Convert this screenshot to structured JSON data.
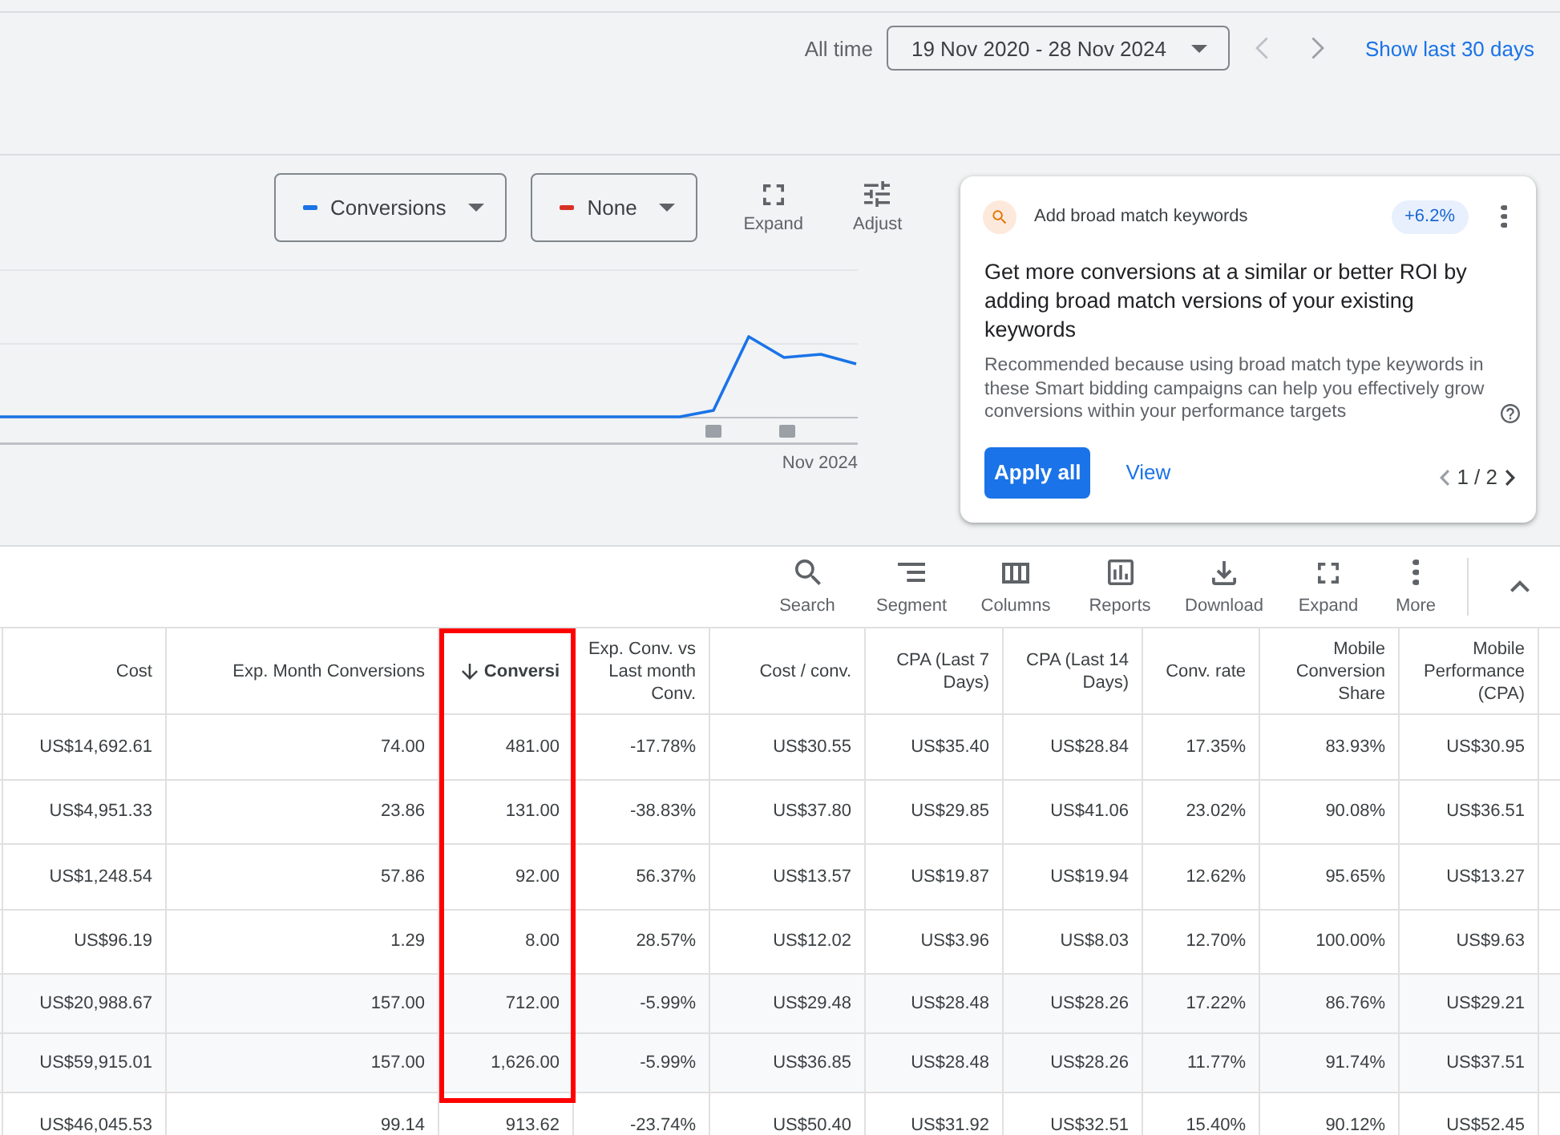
{
  "date_bar": {
    "range_label": "All time",
    "date_range": "19 Nov 2020 - 28 Nov 2024",
    "quick_link": "Show last 30 days"
  },
  "chart": {
    "metrics": [
      {
        "label": "Conversions",
        "color": "#1a73e8"
      },
      {
        "label": "None",
        "color": "#d93025"
      }
    ],
    "tools": [
      {
        "kind": "expand",
        "label": "Expand"
      },
      {
        "kind": "adjust",
        "label": "Adjust"
      }
    ],
    "x_axis_label": "Nov 2024"
  },
  "recommendation": {
    "title": "Add broad match keywords",
    "uplift": "+6.2%",
    "headline": "Get more conversions at a similar or better ROI by adding broad match versions of your existing keywords",
    "description": "Recommended because using broad match type keywords in these Smart bidding campaigns can help you effectively grow conversions within your performance targets",
    "primary_action": "Apply all",
    "secondary_action": "View",
    "pager": "1 / 2"
  },
  "table_toolbar": [
    {
      "kind": "search",
      "label": "Search"
    },
    {
      "kind": "segment",
      "label": "Segment"
    },
    {
      "kind": "columns",
      "label": "Columns"
    },
    {
      "kind": "reports",
      "label": "Reports"
    },
    {
      "kind": "download",
      "label": "Download"
    },
    {
      "kind": "expand",
      "label": "Expand"
    },
    {
      "kind": "more",
      "label": "More"
    }
  ],
  "table": {
    "columns": [
      {
        "label": "Cost",
        "sorted": false,
        "highlighted": false
      },
      {
        "label": "Exp. Month Conversions",
        "sorted": false,
        "highlighted": false
      },
      {
        "label": "Conversi",
        "sorted": true,
        "highlighted": true
      },
      {
        "label": "Exp. Conv. vs Last month Conv.",
        "sorted": false,
        "highlighted": false
      },
      {
        "label": "Cost / conv.",
        "sorted": false,
        "highlighted": false
      },
      {
        "label": "CPA (Last 7 Days)",
        "sorted": false,
        "highlighted": false
      },
      {
        "label": "CPA (Last 14 Days)",
        "sorted": false,
        "highlighted": false
      },
      {
        "label": "Conv. rate",
        "sorted": false,
        "highlighted": false
      },
      {
        "label": "Mobile Conversion Share",
        "sorted": false,
        "highlighted": false
      },
      {
        "label": "Mobile Performance (CPA)",
        "sorted": false,
        "highlighted": false
      }
    ],
    "rows": [
      {
        "shaded": false,
        "cells": [
          "US$14,692.61",
          "74.00",
          "481.00",
          "-17.78%",
          "US$30.55",
          "US$35.40",
          "US$28.84",
          "17.35%",
          "83.93%",
          "US$30.95"
        ]
      },
      {
        "shaded": false,
        "cells": [
          "US$4,951.33",
          "23.86",
          "131.00",
          "-38.83%",
          "US$37.80",
          "US$29.85",
          "US$41.06",
          "23.02%",
          "90.08%",
          "US$36.51"
        ]
      },
      {
        "shaded": false,
        "cells": [
          "US$1,248.54",
          "57.86",
          "92.00",
          "56.37%",
          "US$13.57",
          "US$19.87",
          "US$19.94",
          "12.62%",
          "95.65%",
          "US$13.27"
        ]
      },
      {
        "shaded": false,
        "cells": [
          "US$96.19",
          "1.29",
          "8.00",
          "28.57%",
          "US$12.02",
          "US$3.96",
          "US$8.03",
          "12.70%",
          "100.00%",
          "US$9.63"
        ]
      },
      {
        "shaded": true,
        "cells": [
          "US$20,988.67",
          "157.00",
          "712.00",
          "-5.99%",
          "US$29.48",
          "US$28.48",
          "US$28.26",
          "17.22%",
          "86.76%",
          "US$29.21"
        ]
      },
      {
        "shaded": true,
        "cells": [
          "US$59,915.01",
          "157.00",
          "1,626.00",
          "-5.99%",
          "US$36.85",
          "US$28.48",
          "US$28.26",
          "11.77%",
          "91.74%",
          "US$37.51"
        ]
      },
      {
        "shaded": false,
        "cells": [
          "US$46,045.53",
          "99.14",
          "913.62",
          "-23.74%",
          "US$50.40",
          "US$31.92",
          "US$32.51",
          "15.40%",
          "90.12%",
          "US$52.45"
        ]
      }
    ]
  }
}
